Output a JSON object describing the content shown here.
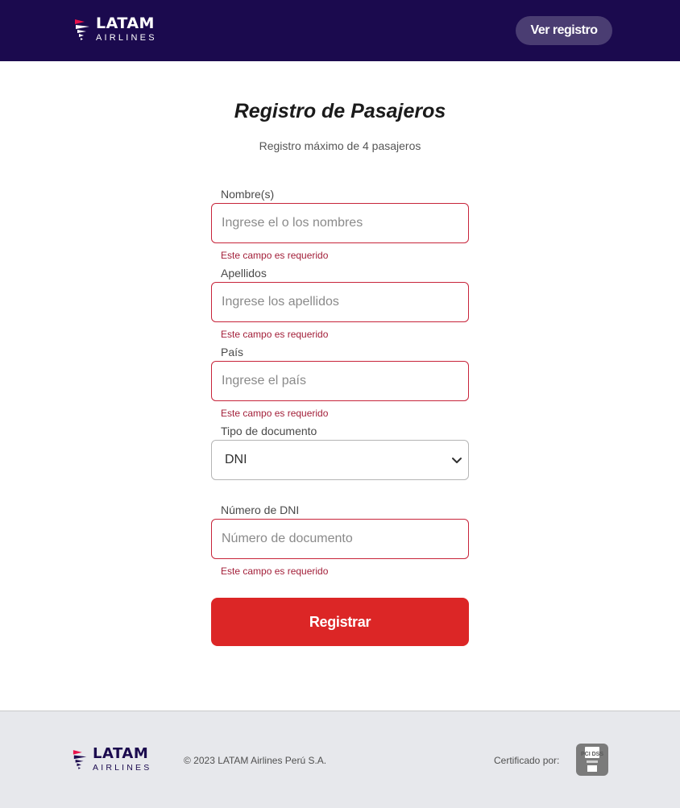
{
  "header": {
    "logo": {
      "brand": "LATAM",
      "sub": "AIRLINES",
      "icon": "latam-logo-icon"
    },
    "view_registry_button": "Ver registro"
  },
  "page": {
    "title": "Registro de Pasajeros",
    "subtitle": "Registro máximo de 4 pasajeros"
  },
  "form": {
    "names": {
      "label": "Nombre(s)",
      "placeholder": "Ingrese el o los nombres",
      "value": "",
      "error": "Este campo es requerido"
    },
    "surnames": {
      "label": "Apellidos",
      "placeholder": "Ingrese los apellidos",
      "value": "",
      "error": "Este campo es requerido"
    },
    "country": {
      "label": "País",
      "placeholder": "Ingrese el país",
      "value": "",
      "error": "Este campo es requerido"
    },
    "doc_type": {
      "label": "Tipo de documento",
      "selected": "DNI"
    },
    "doc_number": {
      "label": "Número de DNI",
      "placeholder": "Número de documento",
      "value": "",
      "error": "Este campo es requerido"
    },
    "submit_label": "Registrar"
  },
  "footer": {
    "logo": {
      "brand": "LATAM",
      "sub": "AIRLINES"
    },
    "copyright": "© 2023 LATAM Airlines Perú S.A.",
    "certified_label": "Certificado por:",
    "badge": {
      "icon": "pci-dss-badge-icon",
      "text": "PCI DSS"
    }
  },
  "colors": {
    "header_bg": "#1b0a4e",
    "accent_red": "#dc2626",
    "error_text": "#a3203a",
    "footer_bg": "#e7e8ec"
  }
}
